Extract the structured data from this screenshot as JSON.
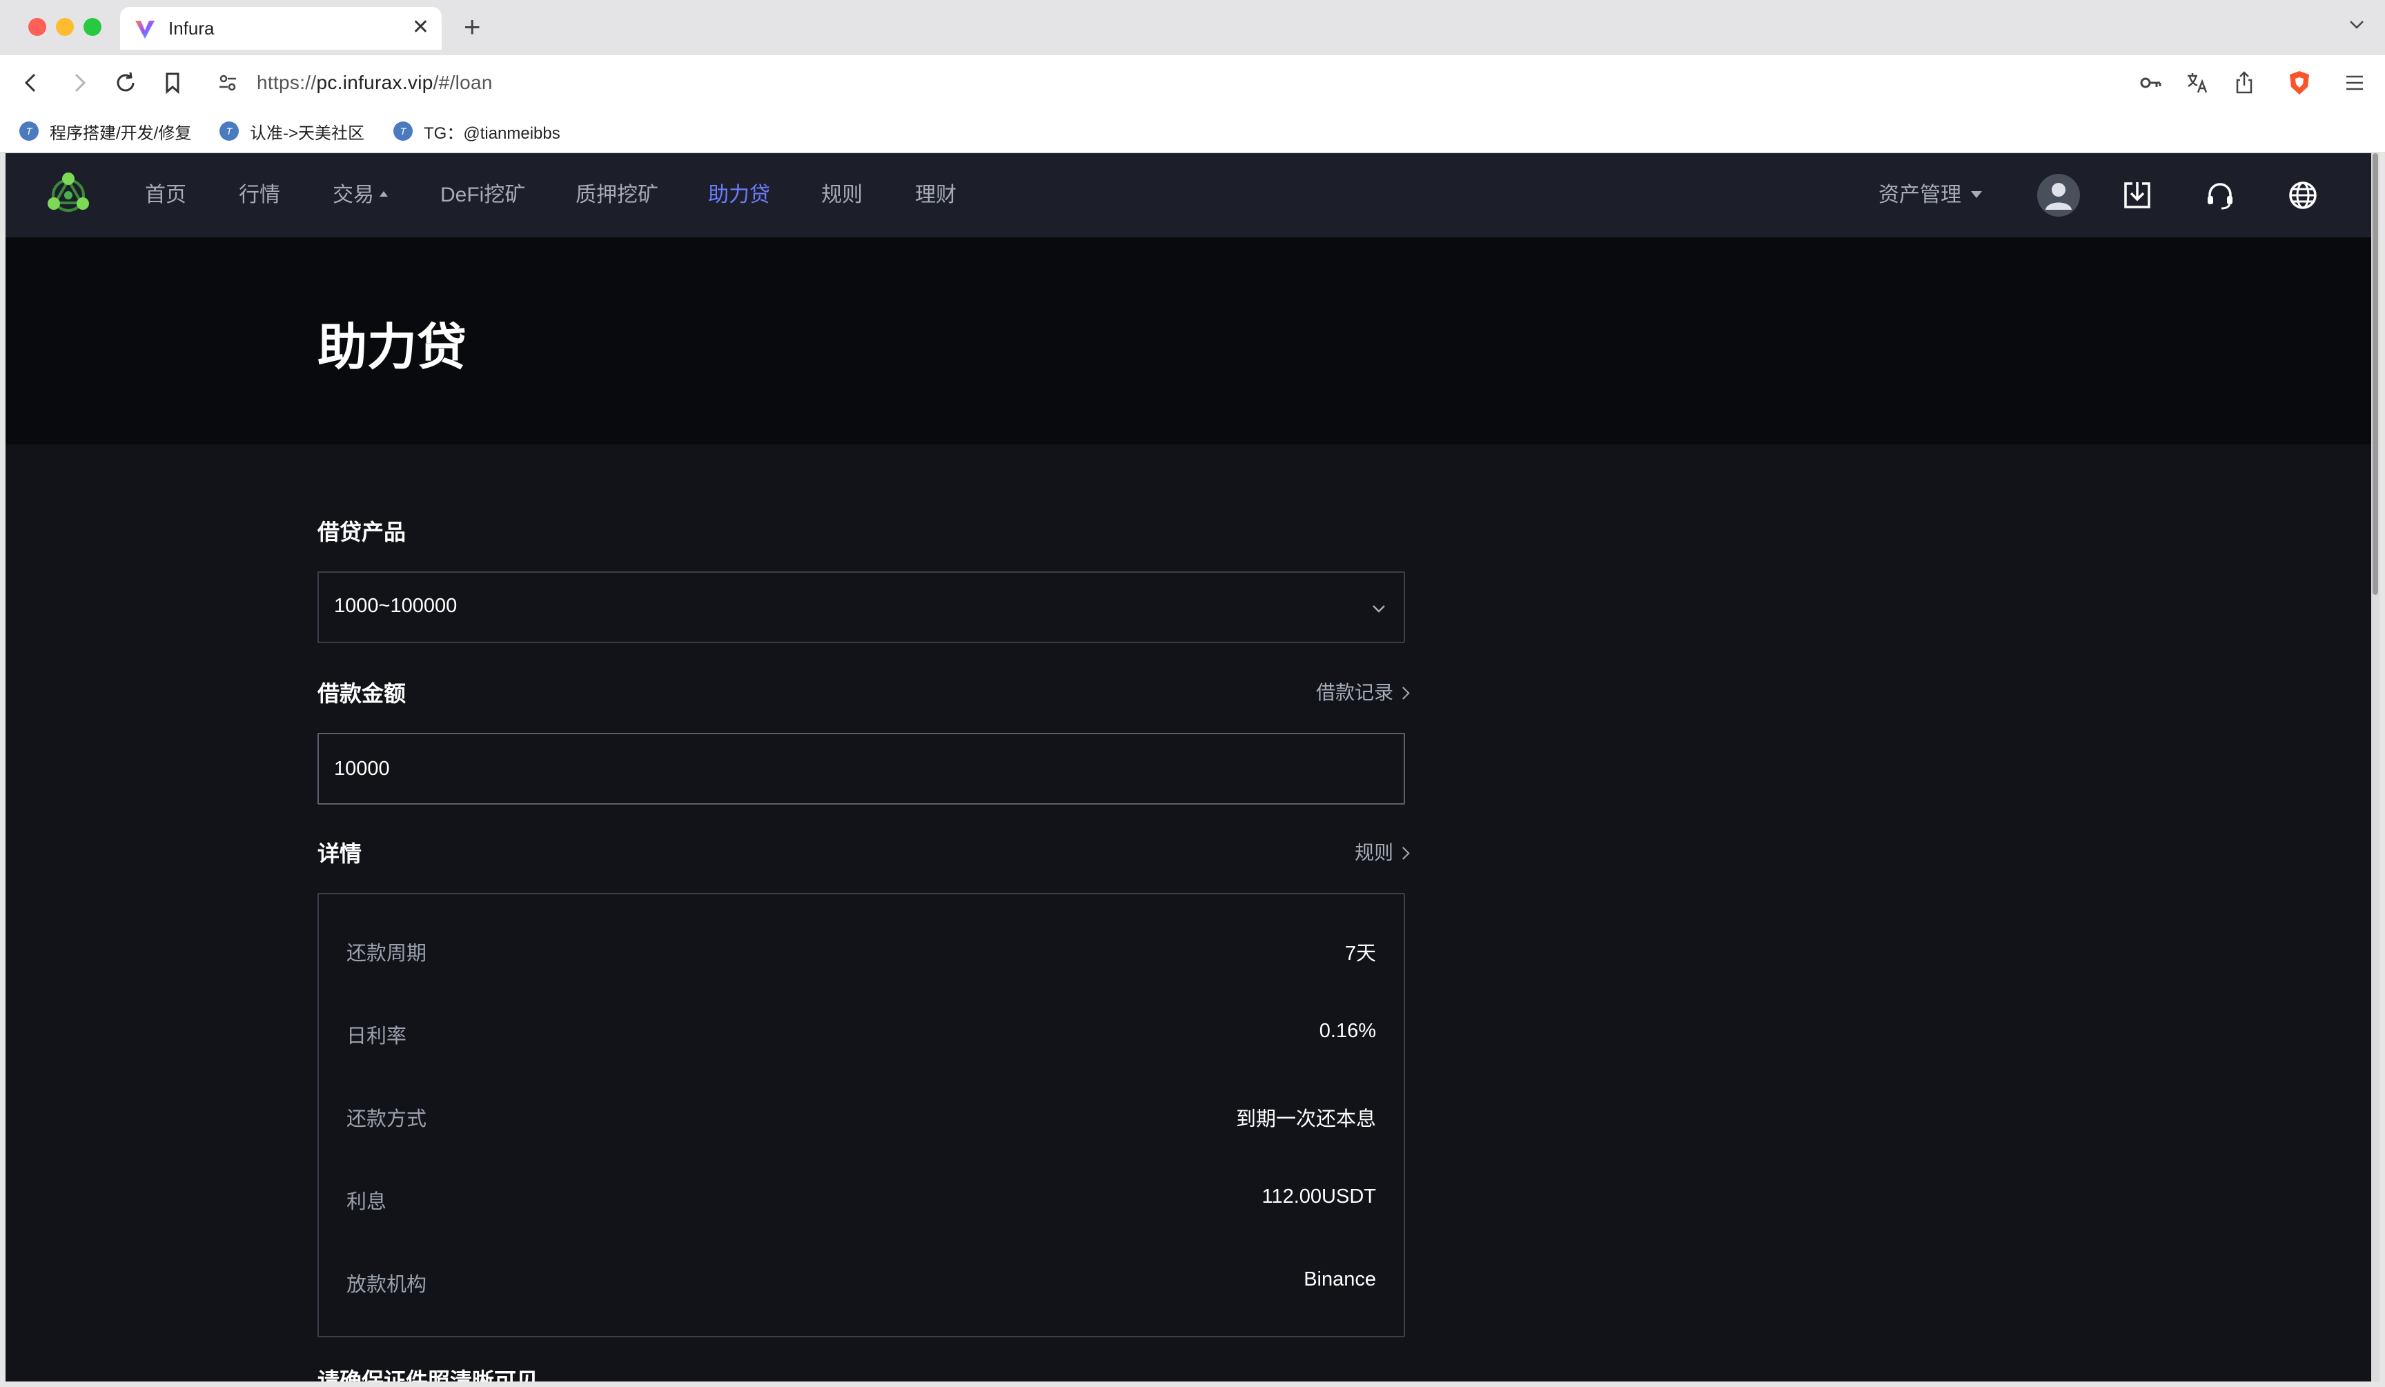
{
  "browser": {
    "tab_title": "Infura",
    "url_prefix": "https://",
    "url_host": "pc.infurax.vip",
    "url_path": "/#/loan",
    "bookmarks": [
      {
        "label": "程序搭建/开发/修复"
      },
      {
        "label": "认准->天美社区"
      },
      {
        "label": "TG：@tianmeibbs"
      }
    ]
  },
  "site_nav": {
    "items": [
      "首页",
      "行情",
      "交易",
      "DeFi挖矿",
      "质押挖矿",
      "助力贷",
      "规则",
      "理财"
    ],
    "active": "助力贷",
    "asset_menu": "资产管理"
  },
  "hero": {
    "title": "助力贷"
  },
  "loan_form": {
    "product_label": "借贷产品",
    "product_value": "1000~100000",
    "amount_label": "借款金额",
    "records_link": "借款记录",
    "amount_value": "10000",
    "details_label": "详情",
    "rules_link": "规则",
    "details": [
      {
        "label": "还款周期",
        "value": "7天"
      },
      {
        "label": "日利率",
        "value": "0.16%"
      },
      {
        "label": "还款方式",
        "value": "到期一次还本息"
      },
      {
        "label": "利息",
        "value": "112.00USDT"
      },
      {
        "label": "放款机构",
        "value": "Binance"
      }
    ],
    "cut_off_text": "请确保证件照清晰可见"
  },
  "colors": {
    "accent": "#6b7cff",
    "nav_bg": "#1c1f29",
    "page_bg": "#111318",
    "hero_bg": "#090a0d"
  }
}
